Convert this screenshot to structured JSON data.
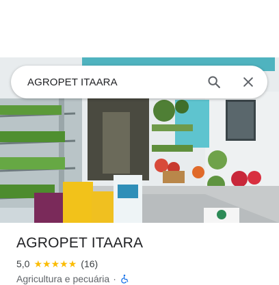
{
  "search": {
    "query": "AGROPET ITAARA",
    "search_icon": "search-icon",
    "clear_icon": "close-icon"
  },
  "photo": {
    "description_icon": "storefront-photo"
  },
  "place": {
    "name": "AGROPET ITAARA",
    "rating": "5,0",
    "stars": 5,
    "review_count": "(16)",
    "category": "Agricultura e pecuária",
    "separator": "·",
    "accessibility_icon": "wheelchair-accessible-icon"
  },
  "colors": {
    "star": "#fbbc04",
    "accessibility": "#1a73e8",
    "text_primary": "#202124",
    "text_secondary": "#5f6368"
  }
}
